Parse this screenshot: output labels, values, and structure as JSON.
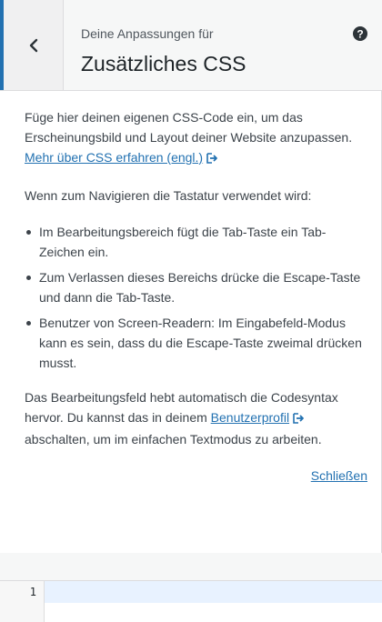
{
  "header": {
    "subtitle": "Deine Anpassungen für",
    "title": "Zusätzliches CSS",
    "back_icon": "chevron-left-icon",
    "help_icon": "help-icon",
    "accent": "#2271b1"
  },
  "content": {
    "intro_text": "Füge hier deinen eigenen CSS-Code ein, um das Erscheinungsbild und Layout deiner Website anzupassen.",
    "intro_link": "Mehr über CSS erfahren (engl.)",
    "keyboard_intro": "Wenn zum Navigieren die Tastatur verwendet wird:",
    "bullets": [
      "Im Bearbeitungsbereich fügt die Tab-Taste ein Tab-Zeichen ein.",
      "Zum Verlassen dieses Bereichs drücke die Escape-Taste und dann die Tab-Taste.",
      "Benutzer von Screen-Readern: Im Eingabefeld-Modus kann es sein, dass du die Escape-Taste zweimal drücken musst."
    ],
    "syntax_text_before": "Das Bearbeitungsfeld hebt automatisch die Codesyntax hervor. Du kannst das in deinem",
    "profile_link": "Benutzerprofil",
    "syntax_text_after": "abschalten, um im einfachen Textmodus zu arbeiten.",
    "close_link": "Schließen"
  },
  "editor": {
    "line_number": "1",
    "active_line_color": "#e8f2ff"
  }
}
